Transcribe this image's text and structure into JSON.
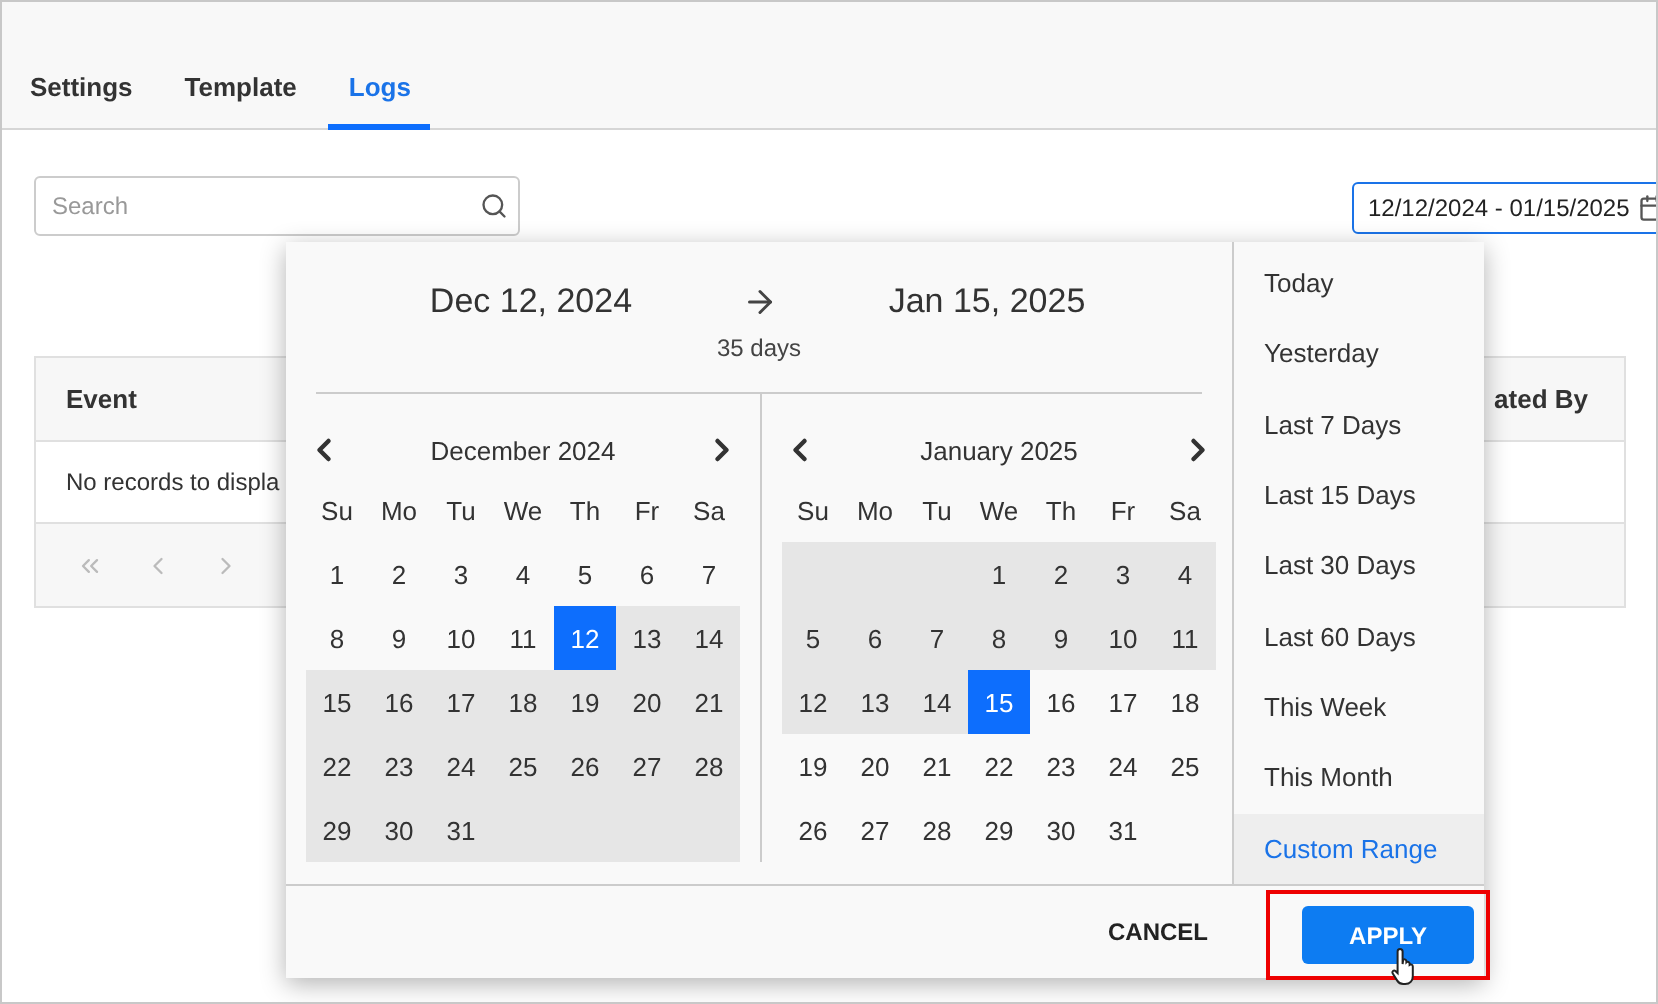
{
  "tabs": [
    {
      "label": "Settings",
      "selected": false
    },
    {
      "label": "Template",
      "selected": false
    },
    {
      "label": "Logs",
      "selected": true
    }
  ],
  "search": {
    "placeholder": "Search"
  },
  "date_range_field": {
    "value": "12/12/2024 - 01/15/2025"
  },
  "table": {
    "columns": [
      "Event",
      "ated By"
    ],
    "empty_message": "No records to displa"
  },
  "date_picker": {
    "start_date": "Dec 12, 2024",
    "end_date": "Jan 15, 2025",
    "duration": "35 days",
    "months": [
      {
        "title": "December 2024",
        "weekdays": [
          "Su",
          "Mo",
          "Tu",
          "We",
          "Th",
          "Fr",
          "Sa"
        ],
        "weeks": [
          [
            {
              "day": "1",
              "in_range": false,
              "selected": false
            },
            {
              "day": "2",
              "in_range": false,
              "selected": false
            },
            {
              "day": "3",
              "in_range": false,
              "selected": false
            },
            {
              "day": "4",
              "in_range": false,
              "selected": false
            },
            {
              "day": "5",
              "in_range": false,
              "selected": false
            },
            {
              "day": "6",
              "in_range": false,
              "selected": false
            },
            {
              "day": "7",
              "in_range": false,
              "selected": false
            }
          ],
          [
            {
              "day": "8",
              "in_range": false,
              "selected": false
            },
            {
              "day": "9",
              "in_range": false,
              "selected": false
            },
            {
              "day": "10",
              "in_range": false,
              "selected": false
            },
            {
              "day": "11",
              "in_range": false,
              "selected": false
            },
            {
              "day": "12",
              "in_range": true,
              "selected": true
            },
            {
              "day": "13",
              "in_range": true,
              "selected": false
            },
            {
              "day": "14",
              "in_range": true,
              "selected": false
            }
          ],
          [
            {
              "day": "15",
              "in_range": true,
              "selected": false
            },
            {
              "day": "16",
              "in_range": true,
              "selected": false
            },
            {
              "day": "17",
              "in_range": true,
              "selected": false
            },
            {
              "day": "18",
              "in_range": true,
              "selected": false
            },
            {
              "day": "19",
              "in_range": true,
              "selected": false
            },
            {
              "day": "20",
              "in_range": true,
              "selected": false
            },
            {
              "day": "21",
              "in_range": true,
              "selected": false
            }
          ],
          [
            {
              "day": "22",
              "in_range": true,
              "selected": false
            },
            {
              "day": "23",
              "in_range": true,
              "selected": false
            },
            {
              "day": "24",
              "in_range": true,
              "selected": false
            },
            {
              "day": "25",
              "in_range": true,
              "selected": false
            },
            {
              "day": "26",
              "in_range": true,
              "selected": false
            },
            {
              "day": "27",
              "in_range": true,
              "selected": false
            },
            {
              "day": "28",
              "in_range": true,
              "selected": false
            }
          ],
          [
            {
              "day": "29",
              "in_range": true,
              "selected": false
            },
            {
              "day": "30",
              "in_range": true,
              "selected": false
            },
            {
              "day": "31",
              "in_range": true,
              "selected": false
            },
            {
              "in_range": true
            },
            {
              "in_range": true
            },
            {
              "in_range": true
            },
            {
              "in_range": true
            }
          ]
        ]
      },
      {
        "title": "January 2025",
        "weekdays": [
          "Su",
          "Mo",
          "Tu",
          "We",
          "Th",
          "Fr",
          "Sa"
        ],
        "weeks": [
          [
            {
              "in_range": true
            },
            {
              "in_range": true
            },
            {
              "in_range": true
            },
            {
              "day": "1",
              "in_range": true,
              "selected": false
            },
            {
              "day": "2",
              "in_range": true,
              "selected": false
            },
            {
              "day": "3",
              "in_range": true,
              "selected": false
            },
            {
              "day": "4",
              "in_range": true,
              "selected": false
            }
          ],
          [
            {
              "day": "5",
              "in_range": true,
              "selected": false
            },
            {
              "day": "6",
              "in_range": true,
              "selected": false
            },
            {
              "day": "7",
              "in_range": true,
              "selected": false
            },
            {
              "day": "8",
              "in_range": true,
              "selected": false
            },
            {
              "day": "9",
              "in_range": true,
              "selected": false
            },
            {
              "day": "10",
              "in_range": true,
              "selected": false
            },
            {
              "day": "11",
              "in_range": true,
              "selected": false
            }
          ],
          [
            {
              "day": "12",
              "in_range": true,
              "selected": false
            },
            {
              "day": "13",
              "in_range": true,
              "selected": false
            },
            {
              "day": "14",
              "in_range": true,
              "selected": false
            },
            {
              "day": "15",
              "in_range": true,
              "selected": true
            },
            {
              "day": "16",
              "in_range": false,
              "selected": false
            },
            {
              "day": "17",
              "in_range": false,
              "selected": false
            },
            {
              "day": "18",
              "in_range": false,
              "selected": false
            }
          ],
          [
            {
              "day": "19",
              "in_range": false,
              "selected": false
            },
            {
              "day": "20",
              "in_range": false,
              "selected": false
            },
            {
              "day": "21",
              "in_range": false,
              "selected": false
            },
            {
              "day": "22",
              "in_range": false,
              "selected": false
            },
            {
              "day": "23",
              "in_range": false,
              "selected": false
            },
            {
              "day": "24",
              "in_range": false,
              "selected": false
            },
            {
              "day": "25",
              "in_range": false,
              "selected": false
            }
          ],
          [
            {
              "day": "26",
              "in_range": false,
              "selected": false
            },
            {
              "day": "27",
              "in_range": false,
              "selected": false
            },
            {
              "day": "28",
              "in_range": false,
              "selected": false
            },
            {
              "day": "29",
              "in_range": false,
              "selected": false
            },
            {
              "day": "30",
              "in_range": false,
              "selected": false
            },
            {
              "day": "31",
              "in_range": false,
              "selected": false
            },
            {
              "in_range": false
            }
          ]
        ]
      }
    ],
    "presets": [
      {
        "label": "Today",
        "selected": false
      },
      {
        "label": "Yesterday",
        "selected": false
      },
      {
        "label": "Last 7 Days",
        "selected": false
      },
      {
        "label": "Last 15 Days",
        "selected": false
      },
      {
        "label": "Last 30 Days",
        "selected": false
      },
      {
        "label": "Last 60 Days",
        "selected": false
      },
      {
        "label": "This Week",
        "selected": false
      },
      {
        "label": "This Month",
        "selected": false
      },
      {
        "label": "Custom Range",
        "selected": true
      }
    ],
    "buttons": {
      "cancel": "CANCEL",
      "apply": "APPLY"
    }
  }
}
